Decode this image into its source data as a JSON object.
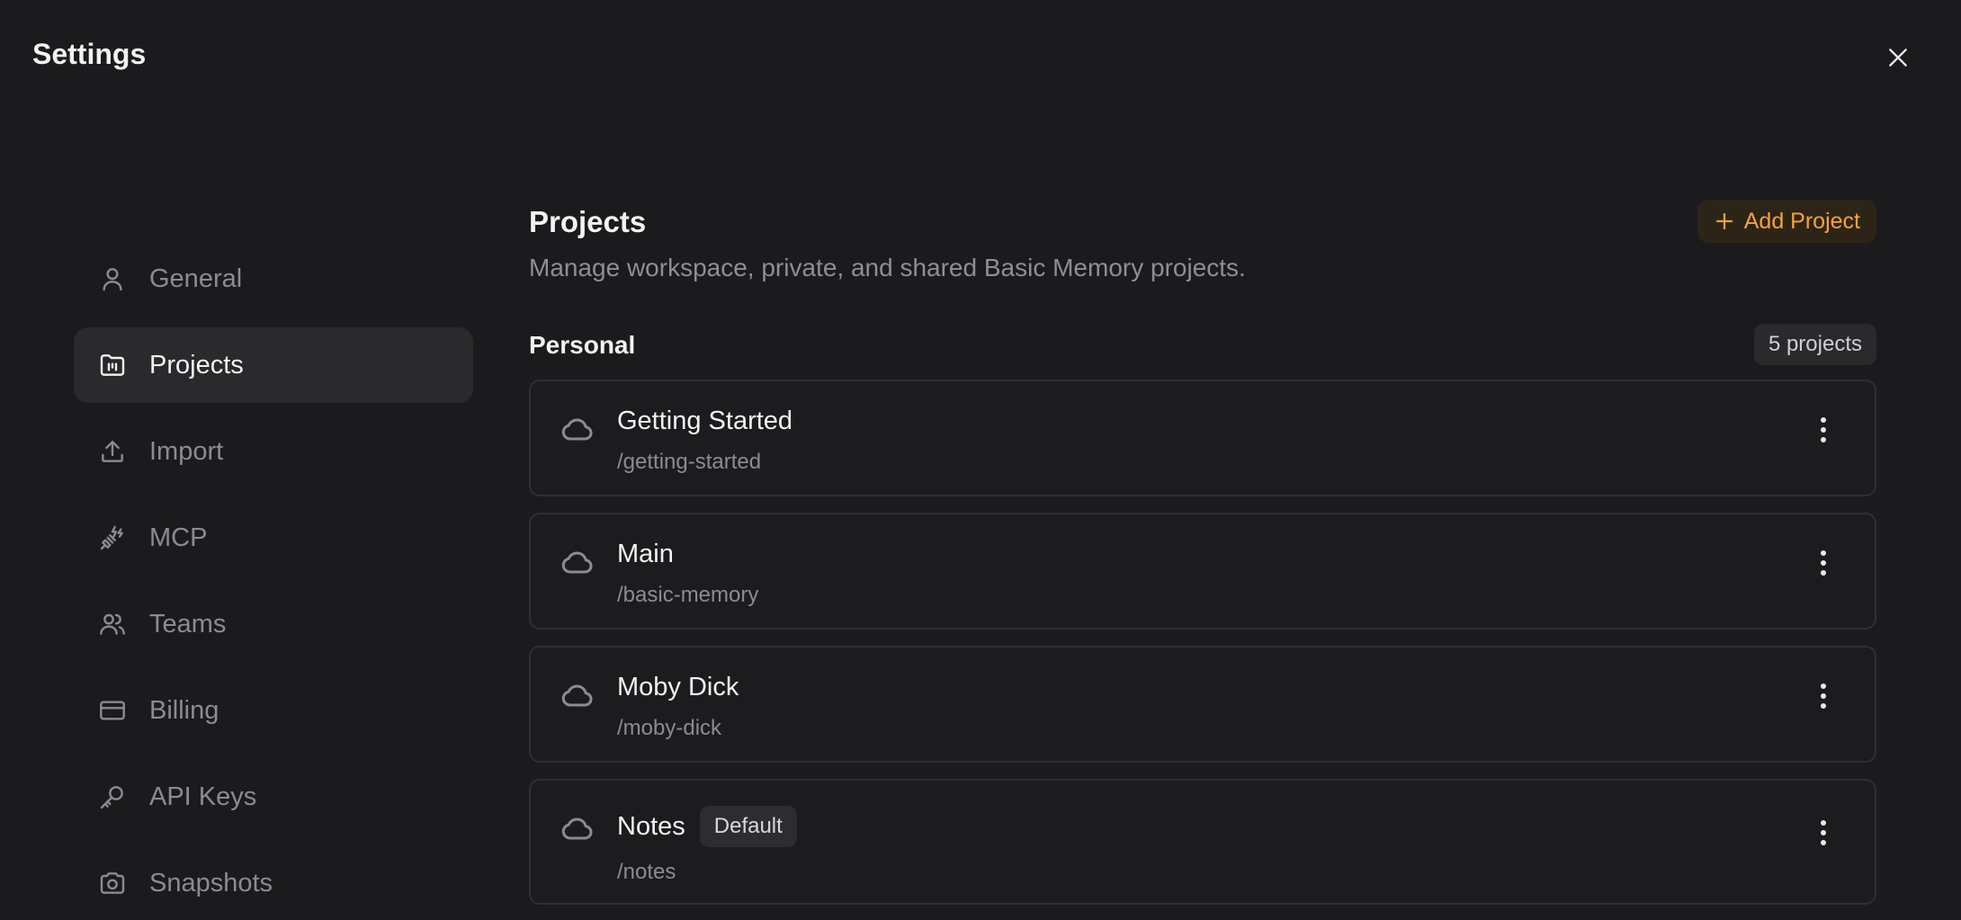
{
  "window": {
    "title": "Settings"
  },
  "sidebar": {
    "items": [
      {
        "label": "General",
        "icon": "user-icon",
        "active": false
      },
      {
        "label": "Projects",
        "icon": "folder-icon",
        "active": true
      },
      {
        "label": "Import",
        "icon": "upload-icon",
        "active": false
      },
      {
        "label": "MCP",
        "icon": "plug-icon",
        "active": false
      },
      {
        "label": "Teams",
        "icon": "users-icon",
        "active": false
      },
      {
        "label": "Billing",
        "icon": "credit-card-icon",
        "active": false
      },
      {
        "label": "API Keys",
        "icon": "key-icon",
        "active": false
      },
      {
        "label": "Snapshots",
        "icon": "camera-icon",
        "active": false
      }
    ]
  },
  "main": {
    "title": "Projects",
    "description": "Manage workspace, private, and shared Basic Memory projects.",
    "add_button_label": "Add Project",
    "group": {
      "title": "Personal",
      "count_label": "5 projects",
      "projects": [
        {
          "name": "Getting Started",
          "path": "/getting-started",
          "badge": ""
        },
        {
          "name": "Main",
          "path": "/basic-memory",
          "badge": ""
        },
        {
          "name": "Moby Dick",
          "path": "/moby-dick",
          "badge": ""
        },
        {
          "name": "Notes",
          "path": "/notes",
          "badge": "Default"
        }
      ]
    }
  },
  "colors": {
    "background": "#1b1b1d",
    "accent": "#f3a33a",
    "active_item_bg": "#2a2a2d",
    "muted_text": "#8b8b92"
  }
}
